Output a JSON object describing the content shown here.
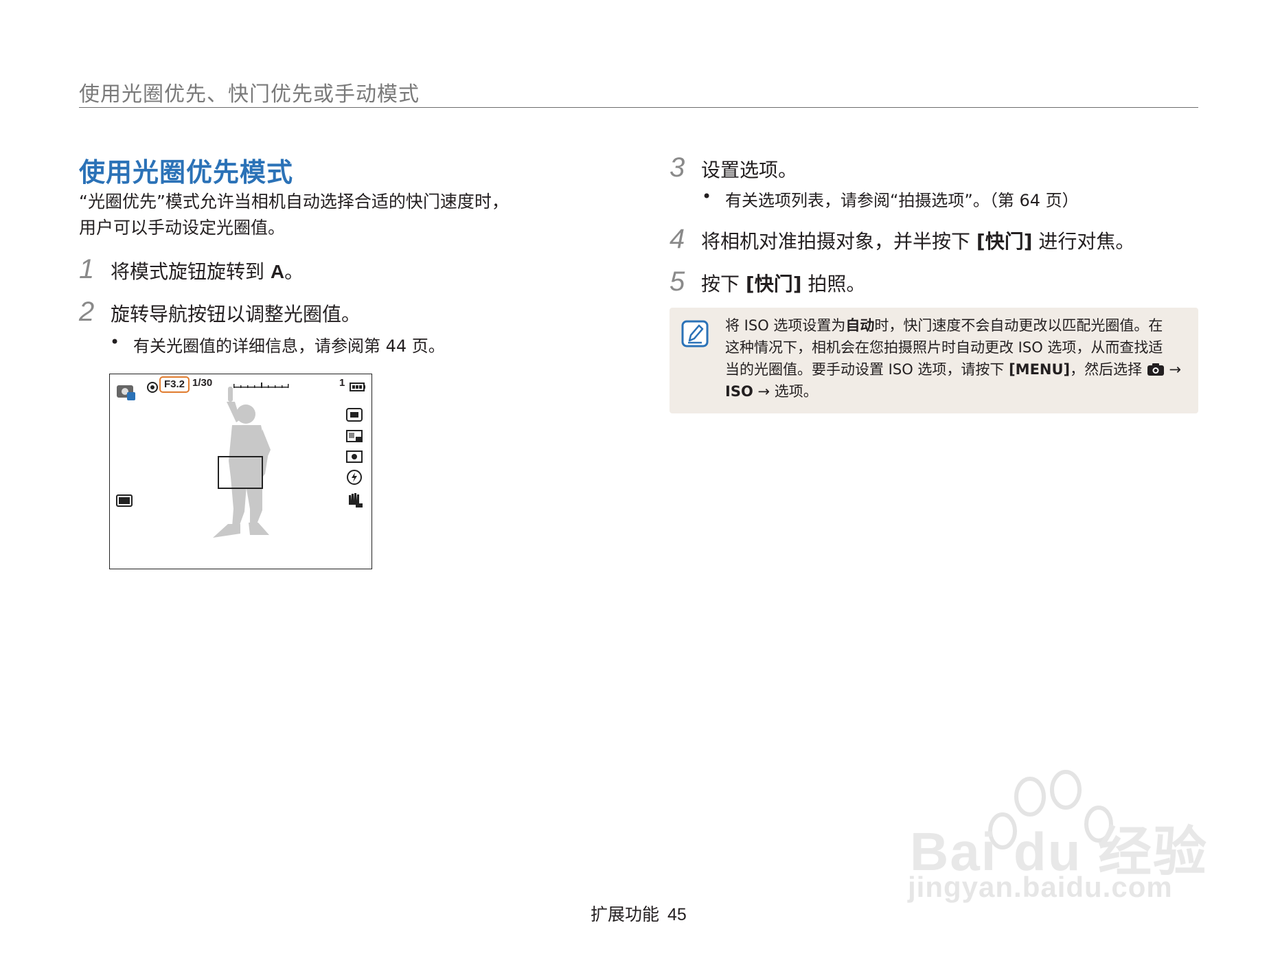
{
  "header": {
    "title": "使用光圈优先、快门优先或手动模式"
  },
  "section": {
    "title": "使用光圈优先模式",
    "intro_line1": "“光圈优先”模式允许当相机自动选择合适的快门速度时，",
    "intro_line2": "用户可以手动设定光圈值。"
  },
  "steps": [
    {
      "num": "1",
      "text": "将模式旋钮旋转到",
      "bold": "A",
      "suffix": "。"
    },
    {
      "num": "2",
      "text": "旋转导航按钮以调整光圈值。",
      "bullet": "有关光圈值的详细信息，请参阅第 44 页。"
    },
    {
      "num": "3",
      "text": "设置选项。",
      "bullet": "有关选项列表，请参阅“拍摄选项”。（第 64 页）"
    },
    {
      "num": "4",
      "text_pre": "将相机对准拍摄对象，并半按下 ",
      "bold": "[快门]",
      "text_post": " 进行对焦。"
    },
    {
      "num": "5",
      "text_pre": "按下 ",
      "bold": "[快门]",
      "text_post": " 拍照。"
    }
  ],
  "viewfinder": {
    "aperture": "F3.2",
    "shutter": "1/30",
    "shots": "1"
  },
  "note": {
    "l1_a": "将 ISO 选项设置为",
    "l1_b": "自动",
    "l1_c": "时，快门速度不会自动更改以匹配光圈值。在",
    "l2": "这种情况下，相机会在您拍摄照片时自动更改 ISO 选项，从而查找适",
    "l3_a": "当的光圈值。要手动设置 ISO 选项，请按下 ",
    "l3_b": "[MENU]",
    "l3_c": "，然后选择 ",
    "l3_d": " →",
    "l4_a": "ISO",
    "l4_b": " → 选项。"
  },
  "footer": {
    "label": "扩展功能",
    "page": "45"
  },
  "watermark": {
    "brand": "Bai du 经验",
    "url": "jingyan.baidu.com"
  },
  "colors": {
    "title_blue": "#2b72b7",
    "note_bg": "#f1ece6",
    "aperture_orange": "#e07b2d"
  }
}
